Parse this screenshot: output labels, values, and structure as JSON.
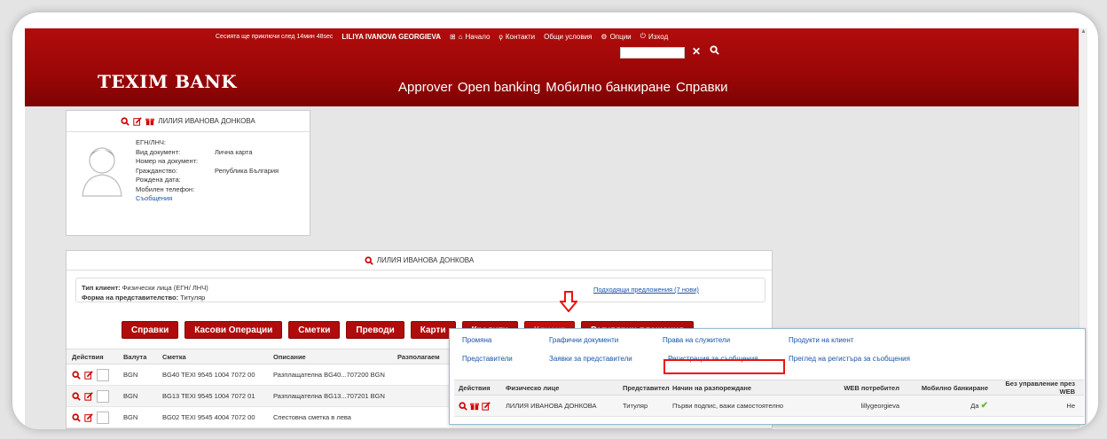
{
  "header": {
    "session_text": "Сесията ще приключи след 14мин 48sec",
    "user_name": "LILIYA IVANOVA GEORGIEVA",
    "links": [
      "Начало",
      "Контакти",
      "Общи условия",
      "Опции",
      "Изход"
    ],
    "logo": "TEXIM BANK",
    "search_value": "",
    "nav": [
      "Approver",
      "Open banking",
      "Мобилно банкиране",
      "Справки"
    ]
  },
  "profile": {
    "title": "ЛИЛИЯ ИВАНОВА ДОНКОВА",
    "labels": [
      "ЕГН/ЛНЧ:",
      "Вид документ:",
      "Номер на документ:",
      "Гражданство:",
      "Рождена дата:",
      "Мобилен телефон:"
    ],
    "values": [
      "",
      "Лична карта",
      "",
      "Република България",
      "",
      ""
    ],
    "messages_link": "Съобщения"
  },
  "client": {
    "title": "ЛИЛИЯ ИВАНОВА ДОНКОВА",
    "type_label": "Тип клиент:",
    "type_value": "Физически лица (ЕГН/ ЛНЧ)",
    "form_label": "Форма на представителство:",
    "form_value": "Титуляр",
    "offers_link": "Подходящи предложения (7 нови)",
    "buttons": [
      "Справки",
      "Касови Операции",
      "Сметки",
      "Преводи",
      "Карти",
      "Кредити",
      "Клиент",
      "Регулярни плащания"
    ]
  },
  "accounts": {
    "headers": [
      "Действия",
      "Валута",
      "Сметка",
      "Описание",
      "Разполагаем"
    ],
    "rows": [
      {
        "currency": "BGN",
        "account": "BG40 TEXI 9545 1004 7072 00",
        "desc": "Разплащателна BG40...707200 BGN"
      },
      {
        "currency": "BGN",
        "account": "BG13 TEXI 9545 1004 7072 01",
        "desc": "Разплащателна BG13...707201 BGN"
      },
      {
        "currency": "BGN",
        "account": "BG02 TEXI 9545 4004 7072 00",
        "desc": "Спестовна сметка в лева"
      }
    ]
  },
  "client_menu": {
    "links_row1": [
      "Промяна",
      "Графични документи",
      "Права на служители",
      "Продукти на клиент"
    ],
    "links_row2": [
      "Представители",
      "Заявки за представители",
      "Регистрация за съобщения",
      "Преглед на регистъра за съобщения"
    ],
    "headers": [
      "Действия",
      "Физическо лице",
      "Представител",
      "Начин на разпореждане",
      "WEB потребител",
      "Мобилно банкиране",
      "Без управление през WEB"
    ],
    "row": {
      "person": "ЛИЛИЯ ИВАНОВА ДОНКОВА",
      "representative": "Титуляр",
      "disposal": "Първи подпис, важи самостоятелно",
      "web_user": "lillygeorgieva",
      "mobile": "Да",
      "no_web": "Не"
    }
  },
  "colors": {
    "brand_red": "#a00808",
    "link_blue": "#1a55a6",
    "highlight": "#e11111"
  }
}
